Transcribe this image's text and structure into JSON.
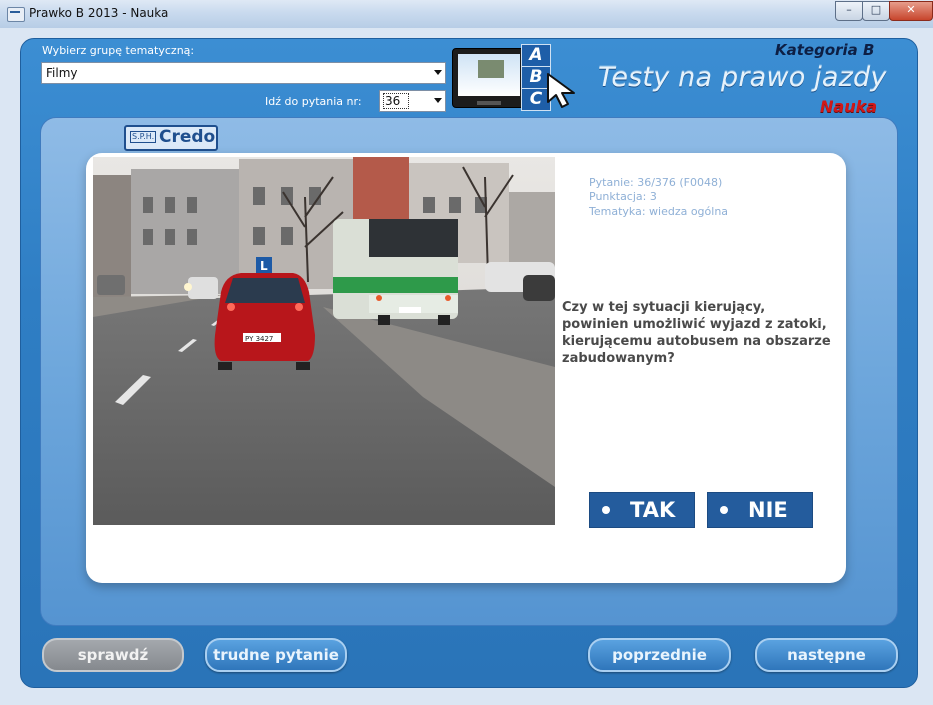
{
  "window": {
    "title": "Prawko B 2013 - Nauka",
    "controls": {
      "minimize": "–",
      "maximize": "□",
      "close": "✕"
    }
  },
  "header": {
    "group_label": "Wybierz grupę tematyczną:",
    "group_value": "Filmy",
    "goto_label": "Idź do pytania nr:",
    "goto_value": "36",
    "tabs": [
      "A",
      "B",
      "C"
    ],
    "kategoria": "Kategoria B",
    "brand": "Testy na prawo jazdy",
    "mode": "Nauka"
  },
  "logo": {
    "sph": "S.P.H.",
    "name": "Credo"
  },
  "question": {
    "pytanie": "Pytanie: 36/376 (F0048)",
    "punktacja": "Punktacja: 3",
    "tematyka": "Tematyka: wiedza ogólna",
    "text": "Czy w tej sytuacji kierujący, powinien umożliwić wyjazd z zatoki, kierującemu autobusem na obszarze zabudowanym?"
  },
  "answers": {
    "yes": "TAK",
    "no": "NIE"
  },
  "buttons": {
    "check": "sprawdź",
    "hard": "trudne pytanie",
    "prev": "poprzednie",
    "next": "następne"
  },
  "photo_plates": {
    "car": "PY 3427"
  }
}
